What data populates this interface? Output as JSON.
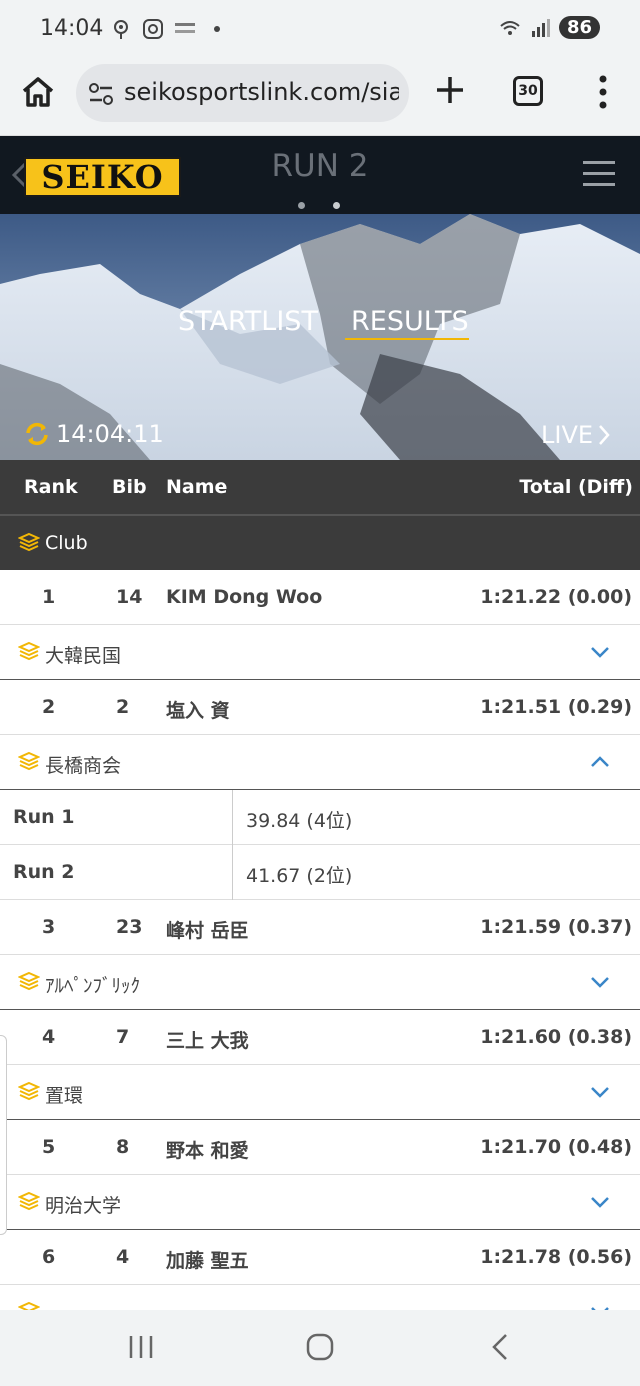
{
  "status_bar": {
    "time": "14:04",
    "battery": "86"
  },
  "browser": {
    "url": "seikosportslink.com/sias",
    "tab_count": "30"
  },
  "site": {
    "logo": "SEIKO",
    "run_title": "RUN 2"
  },
  "hero": {
    "tab_startlist": "STARTLIST",
    "tab_results": "RESULTS",
    "clock": "14:04:11",
    "live": "LIVE"
  },
  "table": {
    "headers": {
      "rank": "Rank",
      "bib": "Bib",
      "name": "Name",
      "total": "Total (Diff)"
    },
    "club_label": "Club",
    "rows": [
      {
        "rank": "1",
        "bib": "14",
        "name": "KIM Dong Woo",
        "total": "1:21.22 (0.00)",
        "club": "大韓民国",
        "expanded": false
      },
      {
        "rank": "2",
        "bib": "2",
        "name": "塩入 資",
        "total": "1:21.51 (0.29)",
        "club": "長橋商会",
        "expanded": true,
        "runs": [
          {
            "label": "Run 1",
            "value": "39.84 (4位)"
          },
          {
            "label": "Run 2",
            "value": "41.67 (2位)"
          }
        ]
      },
      {
        "rank": "3",
        "bib": "23",
        "name": "峰村 岳臣",
        "total": "1:21.59 (0.37)",
        "club": "ｱﾙﾍﾟﾝﾌﾞﾘｯｸ",
        "expanded": false
      },
      {
        "rank": "4",
        "bib": "7",
        "name": "三上 大我",
        "total": "1:21.60 (0.38)",
        "club": "置環",
        "expanded": false
      },
      {
        "rank": "5",
        "bib": "8",
        "name": "野本 和愛",
        "total": "1:21.70 (0.48)",
        "club": "明治大学",
        "expanded": false
      },
      {
        "rank": "6",
        "bib": "4",
        "name": "加藤 聖五",
        "total": "1:21.78 (0.56)",
        "club": "",
        "expanded": false
      }
    ]
  },
  "colors": {
    "accent": "#f2b705",
    "chevron": "#3a86c8",
    "header_bg": "#3b3b3b",
    "logo_bg": "#f7c21a"
  }
}
